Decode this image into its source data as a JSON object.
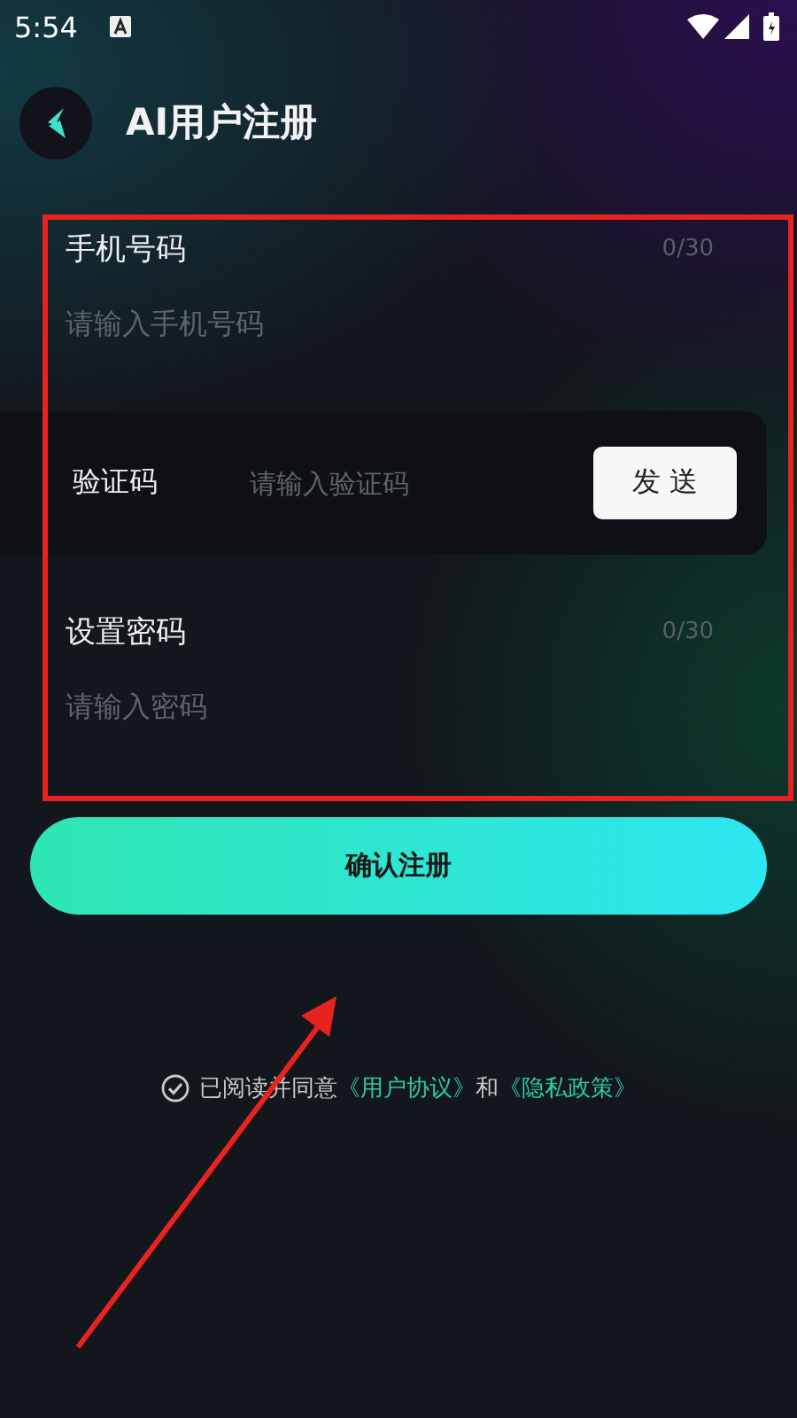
{
  "status_bar": {
    "time": "5:54"
  },
  "header": {
    "title": "AI用户注册"
  },
  "form": {
    "phone": {
      "label": "手机号码",
      "placeholder": "请输入手机号码",
      "counter": "0/30"
    },
    "code": {
      "label": "验证码",
      "placeholder": "请输入验证码",
      "button": "发 送"
    },
    "password": {
      "label": "设置密码",
      "placeholder": "请输入密码",
      "counter": "0/30"
    }
  },
  "submit_button": "确认注册",
  "agreement": {
    "checked": false,
    "text": "已阅读并同意",
    "link_1": "《用户协议》",
    "joiner": "和",
    "link_2": "《隐私政策》"
  }
}
